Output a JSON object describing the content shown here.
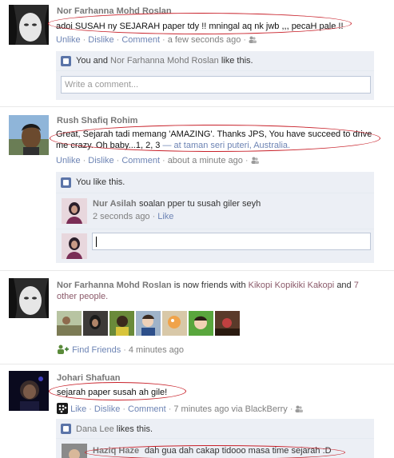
{
  "posts": [
    {
      "author": "Nor Farhanna Mohd Roslan",
      "text": "adoi SUSAH ny SEJARAH paper tdy !! mningal aq nk jwb ,,, pecaH pale !!",
      "actions": {
        "unlike": "Unlike",
        "dislike": "Dislike",
        "comment": "Comment"
      },
      "time": "a few seconds ago",
      "likes_prefix": "You and",
      "likes_name": "Nor Farhanna Mohd Roslan",
      "likes_suffix": "like this.",
      "comment_placeholder": "Write a comment..."
    },
    {
      "author": "Rush Shafiq Rohim",
      "text_line1": "Great, Sejarah tadi memang 'AMAZING'. Thanks JPS, You have succeed to drive",
      "text_line2": "me crazy. Oh baby...1, 2, 3",
      "location": "— at taman seri puteri, Australia.",
      "actions": {
        "unlike": "Unlike",
        "dislike": "Dislike",
        "comment": "Comment"
      },
      "time": "about a minute ago",
      "likes_text": "You like this.",
      "comment": {
        "author": "Nur Asilah",
        "text": "soalan pper tu susah giler seyh",
        "time": "2 seconds ago",
        "like": "Like"
      }
    },
    {
      "author": "Nor Farhanna Mohd Roslan",
      "middle": "is now friends with",
      "friend": "Kikopi Kopikiki Kakopi",
      "and": "and",
      "others": "7",
      "others2": "other people.",
      "find_friends": "Find Friends",
      "time": "4 minutes ago"
    },
    {
      "author": "Johari Shafuan",
      "text": "sejarah paper susah ah gile!",
      "actions": {
        "like": "Like",
        "dislike": "Dislike",
        "comment": "Comment"
      },
      "time": "7 minutes ago via BlackBerry",
      "likes_name": "Dana Lee",
      "likes_suffix": "likes this.",
      "comment": {
        "author": "Haziq Haze",
        "text": "dah gua dah cakap tidooo masa time sejarah :D"
      }
    }
  ],
  "colors": {
    "link": "#3b5998",
    "highlight": "#c8212a",
    "panel": "#eceff5"
  }
}
